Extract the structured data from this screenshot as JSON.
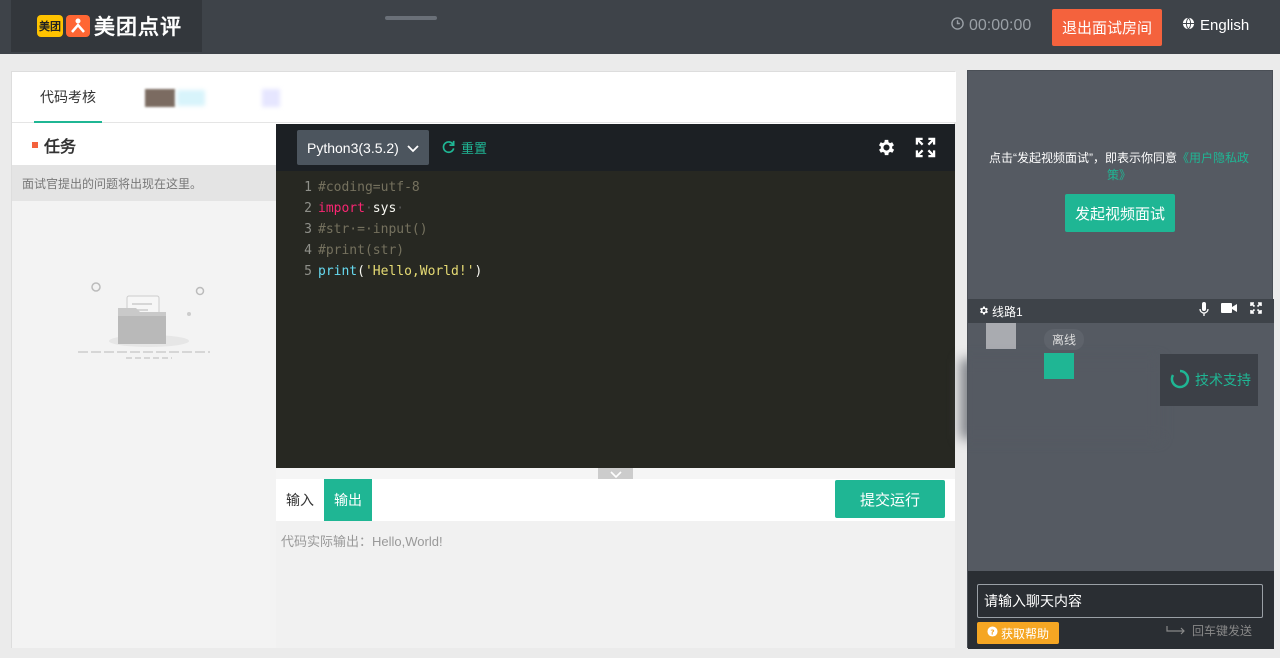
{
  "header": {
    "logo_badge": "美团",
    "logo_text": "美团点评",
    "timer": "00:00:00",
    "exit_label": "退出面试房间",
    "language_label": "English"
  },
  "tabs": [
    {
      "label": "代码考核",
      "active": true
    }
  ],
  "task": {
    "title": "任务",
    "hint": "面试官提出的问题将出现在这里。"
  },
  "editor": {
    "language": "Python3(3.5.2)",
    "reset_label": "重置",
    "lines": [
      {
        "num": "1",
        "parts": [
          {
            "t": "#coding=utf-8",
            "c": "c-comment"
          }
        ]
      },
      {
        "num": "2",
        "parts": [
          {
            "t": "import",
            "c": "c-kw"
          },
          {
            "t": "·",
            "c": "c-dot"
          },
          {
            "t": "sys",
            "c": "c-plain"
          },
          {
            "t": "·",
            "c": "c-dot"
          }
        ]
      },
      {
        "num": "3",
        "parts": [
          {
            "t": "#str·=·input()",
            "c": "c-comment"
          }
        ]
      },
      {
        "num": "4",
        "parts": [
          {
            "t": "#print(str)",
            "c": "c-comment"
          }
        ]
      },
      {
        "num": "5",
        "parts": [
          {
            "t": "print",
            "c": "c-func"
          },
          {
            "t": "(",
            "c": "c-plain"
          },
          {
            "t": "'Hello,World!'",
            "c": "c-str"
          },
          {
            "t": ")",
            "c": "c-plain"
          }
        ]
      }
    ]
  },
  "io": {
    "input_label": "输入",
    "output_label": "输出",
    "run_label": "提交运行",
    "output_text": "代码实际输出：Hello,World!"
  },
  "video": {
    "consent_prefix": "点击“发起视频面试”，即表示你同意",
    "consent_link": "《用户隐私政策》",
    "start_label": "发起视频面试",
    "line_label": "线路1",
    "offline_label": "离线",
    "support_label": "技术支持"
  },
  "chat": {
    "placeholder": "请输入聊天内容",
    "help_label": "获取帮助",
    "enter_send": "回车键发送"
  },
  "colors": {
    "accent": "#1fb694",
    "danger": "#f4623d",
    "help": "#f5a623"
  }
}
